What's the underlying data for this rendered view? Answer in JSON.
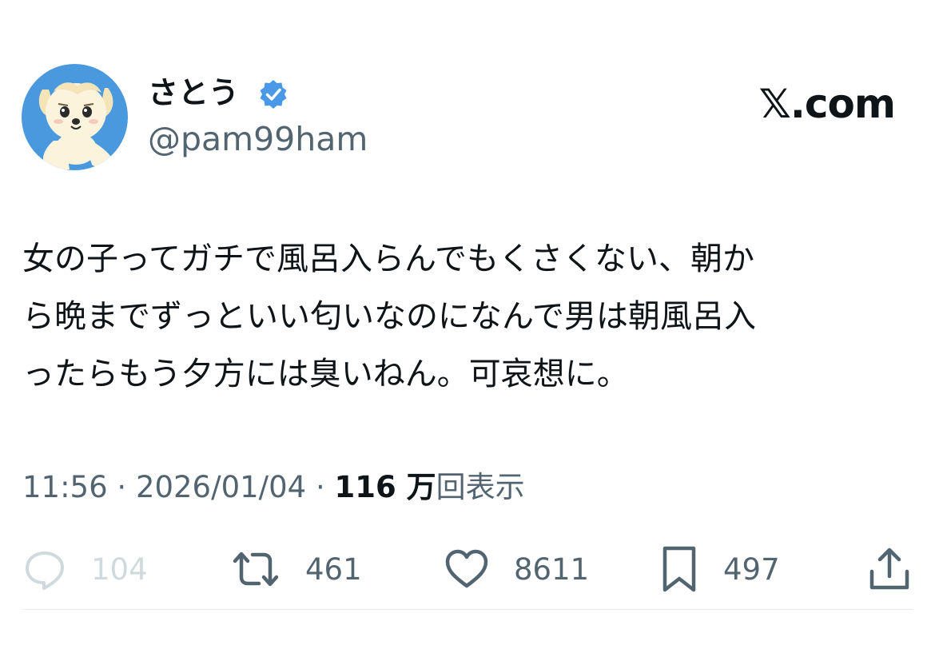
{
  "author": {
    "display_name": "さとう",
    "handle": "@pam99ham",
    "verified": true
  },
  "site_logo": "𝕏.com",
  "tweet": {
    "text": "女の子ってガチで風呂入らんでもくさくない、朝か\nら晩までずっといい匂いなのになんで男は朝風呂入\nったらもう夕方には臭いねん。可哀想に。"
  },
  "meta": {
    "time": "11:56",
    "separator": "·",
    "date": "2026/01/04",
    "views_count": "116 万",
    "views_label": "回表示"
  },
  "actions": {
    "reply_count": "104",
    "retweet_count": "461",
    "like_count": "8611",
    "bookmark_count": "497"
  },
  "colors": {
    "text_primary": "#0f1419",
    "text_secondary": "#536471",
    "verified_badge": "#4a99e9",
    "avatar_background": "#4a98de",
    "reply_disabled": "#cfd9de"
  },
  "icons": {
    "reply": "reply-icon",
    "retweet": "retweet-icon",
    "like": "heart-icon",
    "bookmark": "bookmark-icon",
    "share": "share-icon",
    "verified": "verified-badge-icon"
  }
}
